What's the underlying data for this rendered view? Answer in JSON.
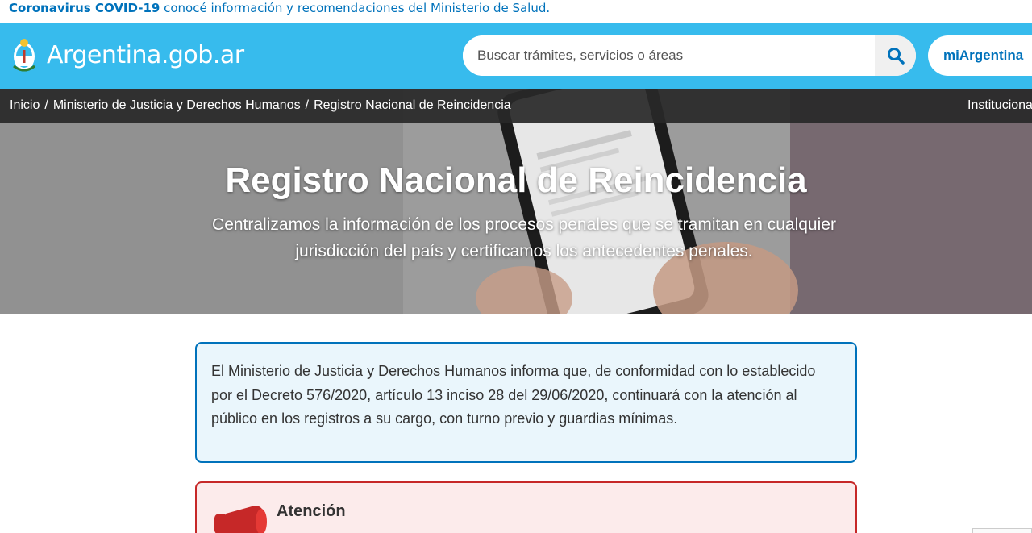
{
  "covid_banner": {
    "strong": "Coronavirus COVID-19",
    "text": " conocé información y recomendaciones del Ministerio de Salud."
  },
  "header": {
    "brand": "Argentina.gob.ar",
    "search_placeholder": "Buscar trámites, servicios o áreas",
    "login_label": "miArgentina"
  },
  "breadcrumb": {
    "items": [
      "Inicio",
      "Ministerio de Justicia y Derechos Humanos",
      "Registro Nacional de Reincidencia"
    ],
    "separator": "/",
    "right_link": "Institucional"
  },
  "hero": {
    "title": "Registro Nacional de Reincidencia",
    "subtitle_line1": "Centralizamos la información de los procesos penales que se tramitan en cualquier",
    "subtitle_line2": "jurisdicción del país y certificamos los antecedentes penales."
  },
  "notice": {
    "line1": "El Ministerio de Justicia y Derechos Humanos informa que, de conformidad con lo establecido",
    "line2": "por el Decreto 576/2020, artículo 13 inciso 28 del 29/06/2020, continuará con la atención al",
    "line3": "público en los registros a su cargo, con turno previo y guardias mínimas."
  },
  "alert": {
    "title": "Atención",
    "icon": "megaphone-icon"
  },
  "colors": {
    "header_bg": "#37bbed",
    "link_blue": "#0072bb",
    "alert_red": "#c62828"
  }
}
